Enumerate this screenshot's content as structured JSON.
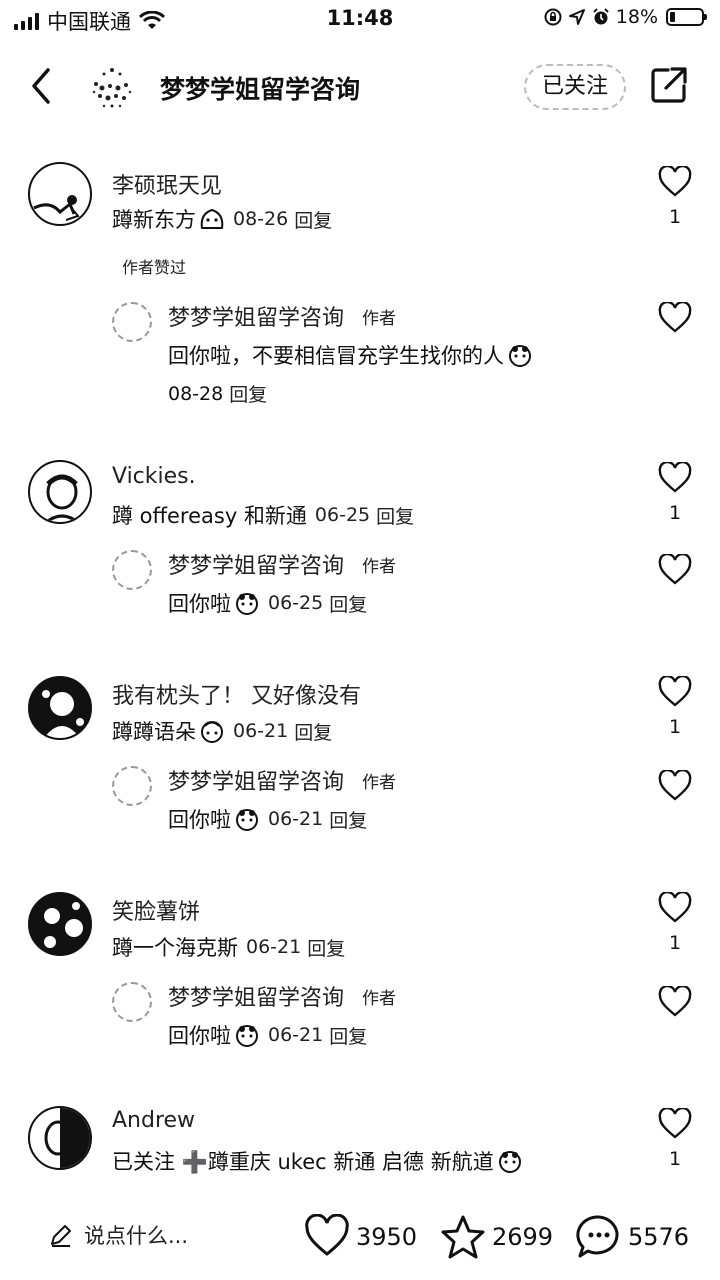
{
  "status_bar": {
    "carrier": "中国联通",
    "time": "11:48",
    "battery": "18%",
    "battery_level": 0.18,
    "icons": [
      "signal-icon",
      "wifi-icon",
      "screen-lock-icon",
      "location-icon",
      "alarm-icon",
      "battery-icon"
    ]
  },
  "header": {
    "title": "梦梦学姐留学咨询",
    "follow_label": "已关注",
    "icons": [
      "back-icon",
      "share-icon"
    ]
  },
  "comments": [
    {
      "user": "李硕珉天见",
      "text": "蹲新东方",
      "emoji": true,
      "date": "08-26",
      "reply_label": "回复",
      "likes": "1",
      "badge": "作者赞过",
      "reply": {
        "user": "梦梦学姐留学咨询",
        "tag": "作者",
        "text": "回你啦，不要相信冒充学生找你的人",
        "date": "08-28",
        "reply_label": "回复"
      }
    },
    {
      "user": "Vickies.",
      "text": "蹲 offereasy 和新通",
      "date": "06-25",
      "reply_label": "回复",
      "likes": "1",
      "reply": {
        "user": "梦梦学姐留学咨询",
        "tag": "作者",
        "text": "回你啦",
        "date": "06-25",
        "reply_label": "回复"
      }
    },
    {
      "user": "我有枕头了！ 又好像没有",
      "text": "蹲蹲语朵",
      "date": "06-21",
      "reply_label": "回复",
      "likes": "1",
      "reply": {
        "user": "梦梦学姐留学咨询",
        "tag": "作者",
        "text": "回你啦",
        "date": "06-21",
        "reply_label": "回复"
      }
    },
    {
      "user": "笑脸薯饼",
      "text": "蹲一个海克斯",
      "date": "06-21",
      "reply_label": "回复",
      "likes": "1",
      "reply": {
        "user": "梦梦学姐留学咨询",
        "tag": "作者",
        "text": "回你啦",
        "date": "06-21",
        "reply_label": "回复"
      }
    },
    {
      "user": "Andrew",
      "text": "已关注 ➕蹲重庆 ukec 新通 启德 新航道",
      "likes": "1"
    }
  ],
  "bottom_bar": {
    "input_placeholder": "说点什么...",
    "likes": "3950",
    "stars": "2699",
    "comments": "5576"
  }
}
